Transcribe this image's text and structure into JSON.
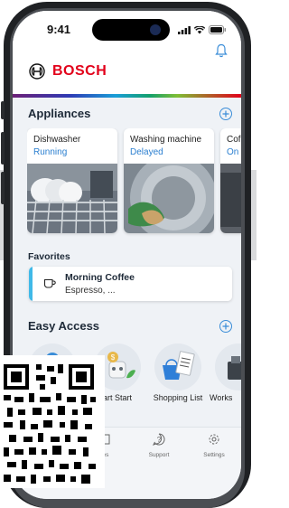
{
  "status_bar": {
    "time": "9:41"
  },
  "brand": {
    "name": "BOSCH",
    "color": "#e2001a"
  },
  "colors": {
    "accent": "#3a8dd8",
    "status_text": "#2b7fd0",
    "favorite_bar": "#40b9e8"
  },
  "appliances": {
    "title": "Appliances",
    "add_icon": "plus-circle-icon",
    "items": [
      {
        "name": "Dishwasher",
        "status": "Running"
      },
      {
        "name": "Washing machine",
        "status": "Delayed"
      },
      {
        "name": "Cof",
        "status": "On"
      }
    ]
  },
  "favorites": {
    "title": "Favorites",
    "items": [
      {
        "title": "Morning Coffee",
        "subtitle": "Espresso, ..."
      }
    ]
  },
  "easy_access": {
    "title": "Easy Access",
    "add_icon": "plus-circle-icon",
    "items": [
      {
        "label": ""
      },
      {
        "label": "art Start"
      },
      {
        "label": "Shopping List"
      },
      {
        "label": "Works"
      }
    ]
  },
  "tab_bar": {
    "items": [
      {
        "label": "es",
        "icon": "recipes-icon"
      },
      {
        "label": "Support",
        "icon": "support-icon"
      },
      {
        "label": "Settings",
        "icon": "settings-icon"
      }
    ]
  }
}
